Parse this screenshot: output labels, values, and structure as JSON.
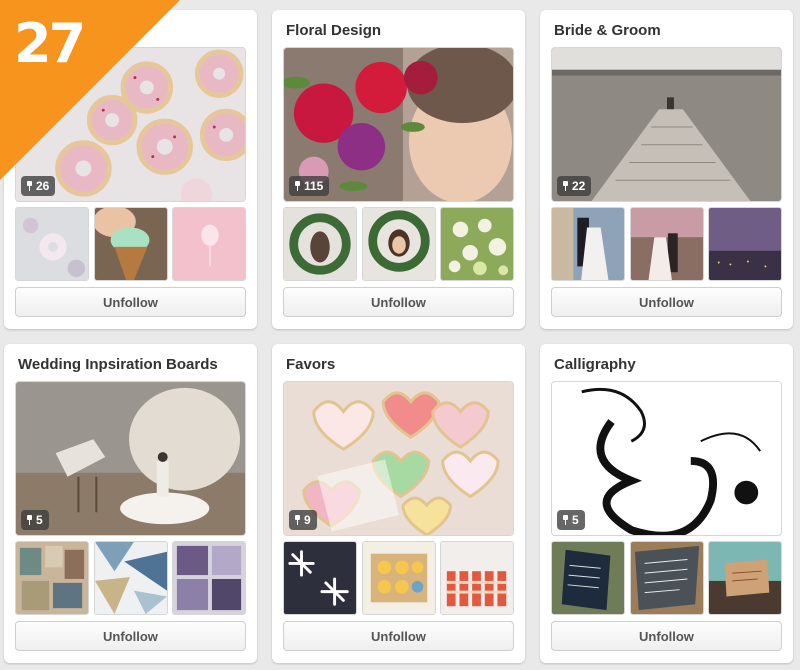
{
  "rank_badge": {
    "number": "27",
    "color": "#f7941d"
  },
  "boards": [
    {
      "title": "",
      "pin_count": "26",
      "cover_image": "donuts-photo",
      "thumbnails": [
        "donut-photo",
        "ice-cream-cone-photo",
        "cotton-candy-photo"
      ],
      "button_label": "Unfollow"
    },
    {
      "title": "Floral Design",
      "pin_count": "115",
      "cover_image": "flower-crown-photo",
      "thumbnails": [
        "wreath-portrait-photo",
        "wreath-portrait-photo-2",
        "floral-arrangement-photo"
      ],
      "button_label": "Unfollow"
    },
    {
      "title": "Bride & Groom",
      "pin_count": "22",
      "cover_image": "dock-lake-photo",
      "thumbnails": [
        "couple-kissing-photo",
        "couple-sunset-photo",
        "city-dusk-photo"
      ],
      "button_label": "Unfollow"
    },
    {
      "title": "Wedding Inpsiration Boards",
      "pin_count": "5",
      "cover_image": "peacock-bride-photo",
      "thumbnails": [
        "collage-board-photo",
        "blue-collage-photo",
        "purple-collage-photo"
      ],
      "button_label": "Unfollow"
    },
    {
      "title": "Favors",
      "pin_count": "9",
      "cover_image": "heart-cookies-photo",
      "thumbnails": [
        "snowflake-favors-photo",
        "macaron-box-photo",
        "striped-bottles-photo"
      ],
      "button_label": "Unfollow"
    },
    {
      "title": "Calligraphy",
      "pin_count": "5",
      "cover_image": "ampersand-calligraphy-photo",
      "thumbnails": [
        "chalkboard-sign-photo",
        "slate-calligraphy-photo",
        "kraft-card-photo"
      ],
      "button_label": "Unfollow"
    }
  ]
}
